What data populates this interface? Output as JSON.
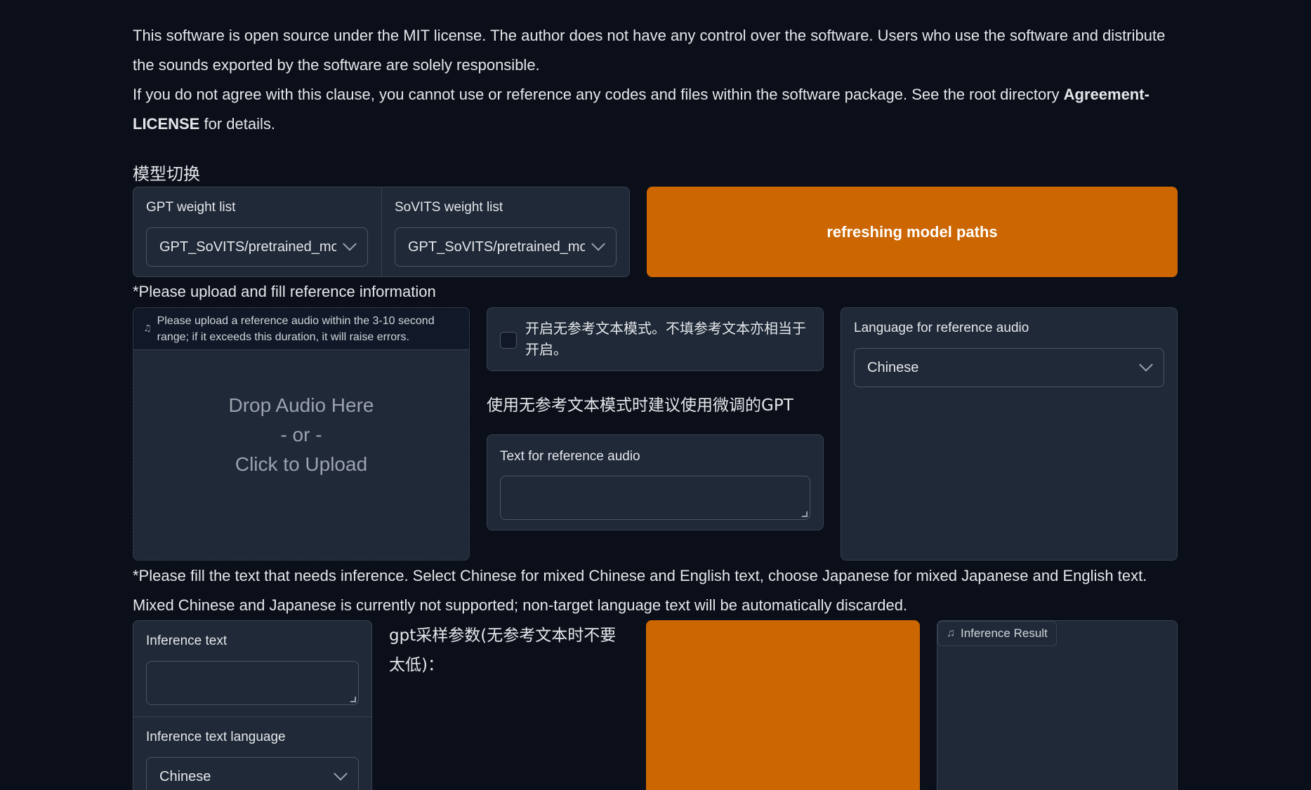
{
  "intro": {
    "line1": "This software is open source under the MIT license. The author does not have any control over the software. Users who use the software and distribute the sounds exported by the software are solely responsible.",
    "line2_pre": "If you do not agree with this clause, you cannot use or reference any codes and files within the software package. See the root directory ",
    "line2_bold": "Agreement-LICENSE",
    "line2_post": " for details."
  },
  "model_switch": {
    "title": "模型切换",
    "gpt_label": "GPT weight list",
    "gpt_value": "GPT_SoVITS/pretrained_models",
    "sovits_label": "SoVITS weight list",
    "sovits_value": "GPT_SoVITS/pretrained_models",
    "refresh_label": "refreshing model paths"
  },
  "reference": {
    "title": "*Please upload and fill reference information",
    "audio_hint": "Please upload a reference audio within the 3-10 second range; if it exceeds this duration, it will raise errors.",
    "drop_line1": "Drop Audio Here",
    "drop_line2": "- or -",
    "drop_line3": "Click to Upload",
    "no_ref_checkbox_label": "开启无参考文本模式。不填参考文本亦相当于开启。",
    "no_ref_tip": "使用无参考文本模式时建议使用微调的GPT",
    "text_label": "Text for reference audio",
    "text_value": "",
    "lang_label": "Language for reference audio",
    "lang_value": "Chinese"
  },
  "inference": {
    "instructions_line1": "*Please fill the text that needs inference. Select Chinese for mixed Chinese and English text, choose Japanese for mixed Japanese and English text.",
    "instructions_line2": "Mixed Chinese and Japanese is currently not supported; non-target language text will be automatically discarded.",
    "text_label": "Inference text",
    "text_value": "",
    "lang_label": "Inference text language",
    "lang_value": "Chinese",
    "gpt_params_label": "gpt采样参数(无参考文本时不要太低)：",
    "result_label": "Inference Result"
  },
  "colors": {
    "background": "#0b0f19",
    "panel": "#1f2937",
    "accent": "#cc6600"
  },
  "icons": [
    "music-note-icon",
    "chevron-down-icon"
  ]
}
